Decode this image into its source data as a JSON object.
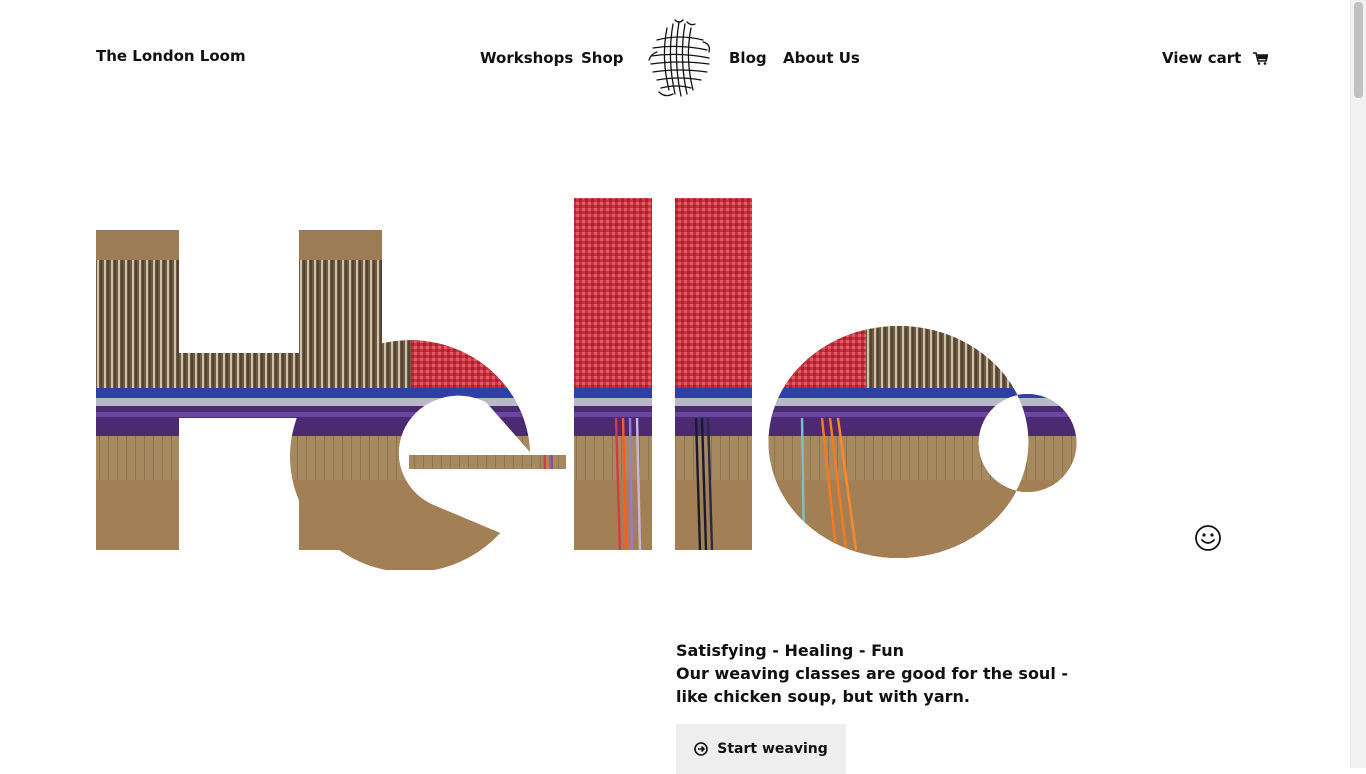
{
  "header": {
    "brand": "The London Loom",
    "nav": {
      "workshops": "Workshops",
      "shop": "Shop",
      "blog": "Blog",
      "about": "About Us"
    },
    "cart_label": "View cart",
    "logo_icon": "woven-yarn-logo-icon",
    "cart_icon": "shopping-cart-icon"
  },
  "hero": {
    "headline": "Hello",
    "smiley_icon": "smiley-face-icon"
  },
  "intro": {
    "tagline": "Satisfying - Healing - Fun",
    "body": "Our weaving classes are good for the soul - like chicken soup, but with yarn."
  },
  "cta": {
    "label": "Start weaving",
    "icon": "arrow-circle-right-icon"
  },
  "colors": {
    "text": "#111111",
    "button_bg": "#eeeeee",
    "loom_wood": "#8a6e4b",
    "loom_purple": "#4b2a72",
    "yarn_red": "#d63a48",
    "yarn_blue": "#2f3fa8"
  }
}
